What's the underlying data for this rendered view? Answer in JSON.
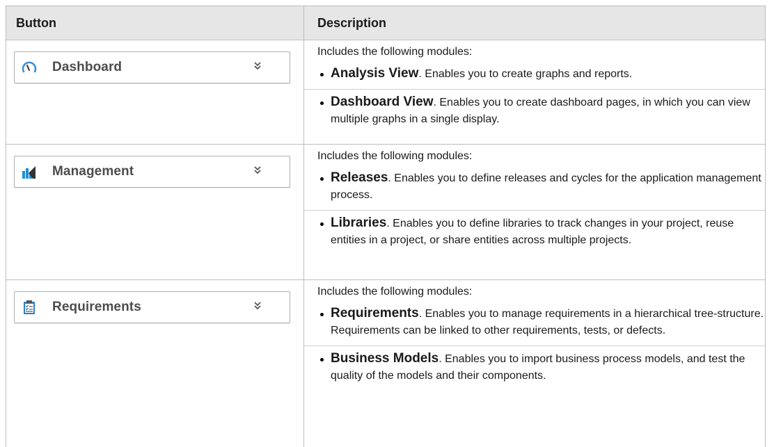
{
  "header": {
    "col1": "Button",
    "col2": "Description"
  },
  "rows": [
    {
      "button": {
        "label": "Dashboard",
        "icon": "gauge-icon",
        "color": "#3b8fd0"
      },
      "intro": "Includes the following modules:",
      "items": [
        {
          "term": "Analysis View",
          "text": ". Enables you to create graphs and reports."
        },
        {
          "term": "Dashboard View",
          "text": ". Enables you to create dashboard pages, in which you can view multiple graphs in a single display."
        }
      ]
    },
    {
      "button": {
        "label": "Management",
        "icon": "bar-chart-icon",
        "color": "#1f8ed8"
      },
      "intro": "Includes the following modules:",
      "items": [
        {
          "term": "Releases",
          "text": ". Enables you to define releases and cycles for the application management process."
        },
        {
          "term": "Libraries",
          "text": ". Enables you to define libraries to track changes in your project, reuse entities in a project, or share entities across multiple projects."
        }
      ]
    },
    {
      "button": {
        "label": "Requirements",
        "icon": "clipboard-checklist-icon",
        "color": "#2f7fc1"
      },
      "intro": "Includes the following modules:",
      "items": [
        {
          "term": "Requirements",
          "text": ". Enables you to manage requirements in a hierarchical tree-structure. Requirements can be linked to other requirements, tests, or defects."
        },
        {
          "term": "Business Models",
          "text": ". Enables you to import business process models, and test the quality of the models and their components."
        }
      ]
    }
  ]
}
